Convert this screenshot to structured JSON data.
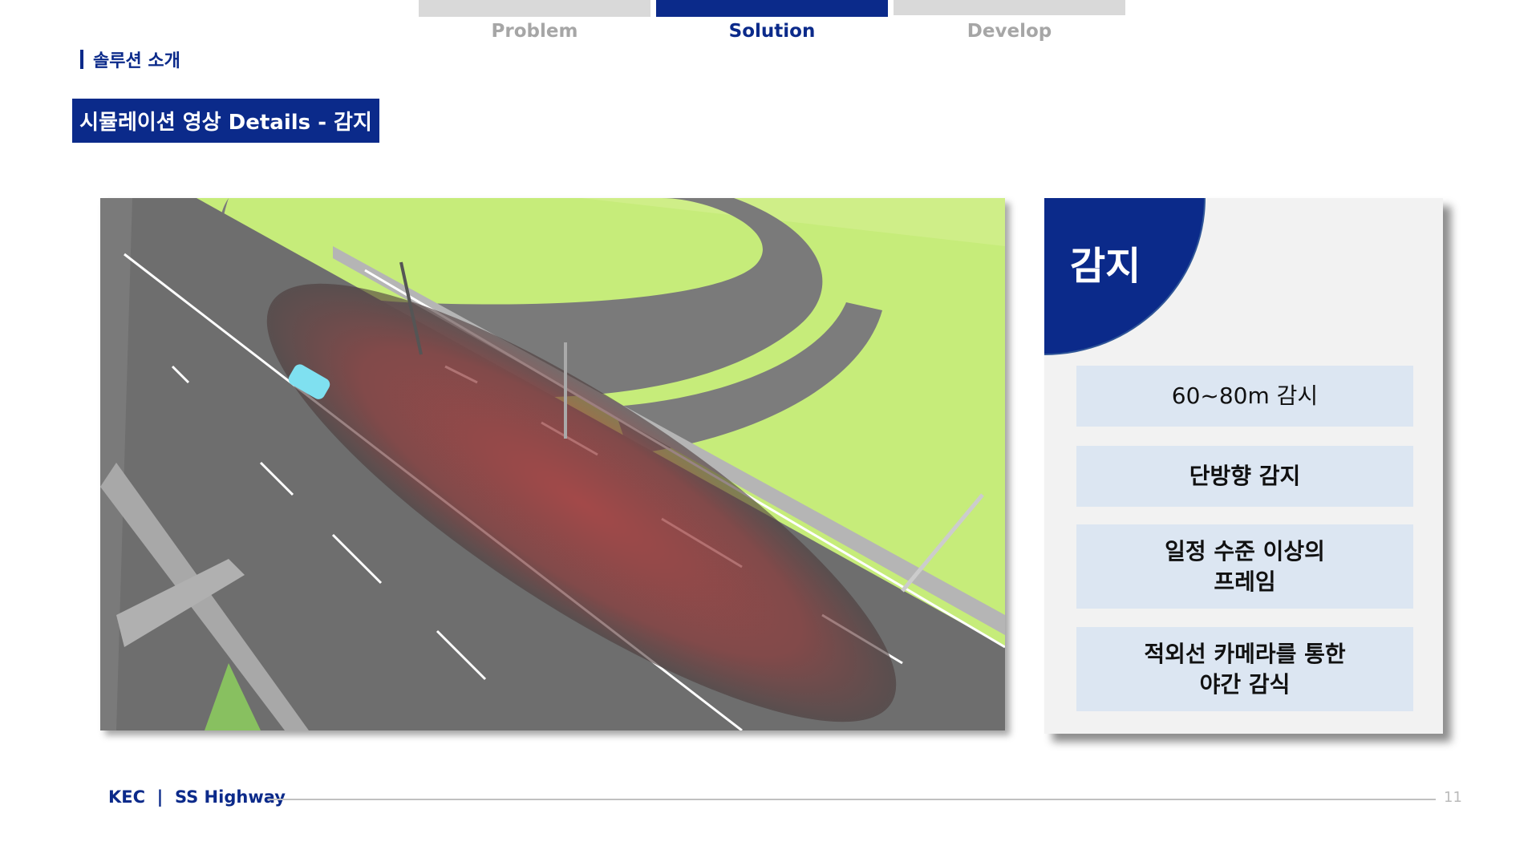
{
  "nav": {
    "tabs": [
      {
        "label": "Problem",
        "active": false
      },
      {
        "label": "Solution",
        "active": true
      },
      {
        "label": "Develop",
        "active": false
      }
    ]
  },
  "section_label": "솔루션 소개",
  "title": "시뮬레이션 영상 Details - 감지",
  "panel": {
    "heading": "감지",
    "items": [
      "60~80m 감시",
      "단방향 감지",
      "일정 수준 이상의\n프레임",
      "적외선 카메라를 통한\n야간 감식"
    ]
  },
  "footer": {
    "brand": "KEC  |  SS Highway",
    "page": "11"
  },
  "colors": {
    "primary": "#0b2a8a",
    "inactive_tab": "#d9d9d9",
    "item_bg": "#dce6f2",
    "panel_bg": "#f2f2f2"
  }
}
